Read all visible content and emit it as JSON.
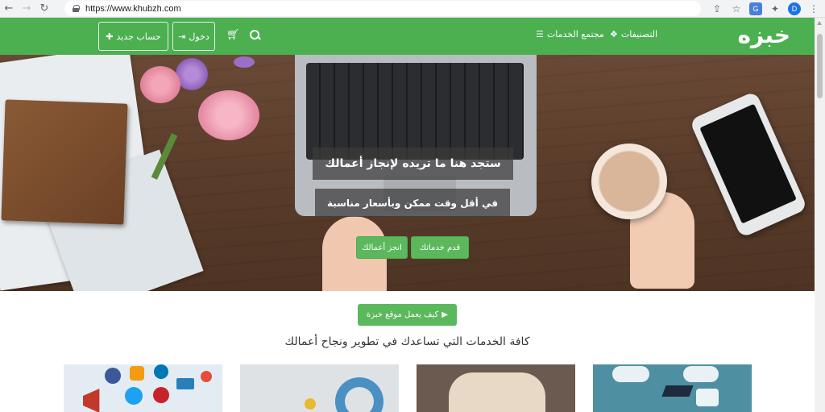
{
  "browser": {
    "url": "https://www.khubzh.com",
    "profile_initial": "D"
  },
  "site": {
    "logo": "خبزه",
    "accent_color": "#4caf50",
    "nav": {
      "categories": "التصنيفات",
      "community": "مجتمع الخدمات",
      "login": "دخول",
      "register": "حساب جديد"
    }
  },
  "hero": {
    "line1": "ستجد هنا ما تريده لإنجاز أعمالك",
    "line2": "في أقل وقت ممكن وبأسعار مناسبة",
    "btn_offer": "قدم خدماتك",
    "btn_work": "انجز أعمالك"
  },
  "main": {
    "how_button": "كيف يعمل موقع خبزة",
    "tagline": "كافة الخدمات التي تساعدك في تطوير ونجاح أعمالك"
  }
}
